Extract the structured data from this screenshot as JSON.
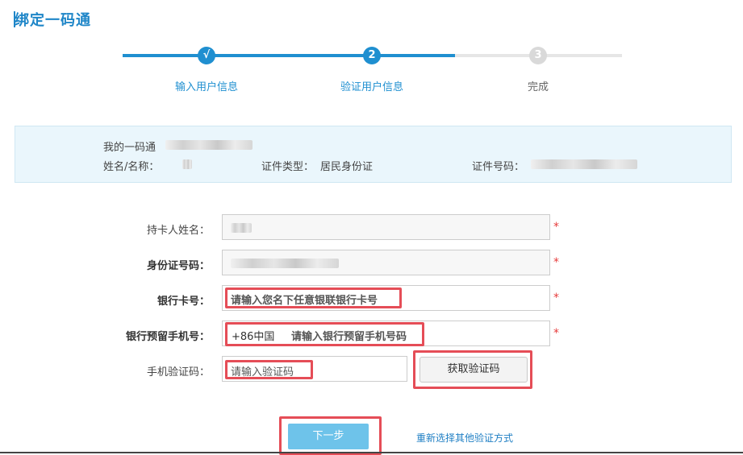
{
  "page": {
    "title": "绑定一码通"
  },
  "steps": [
    {
      "number": "√",
      "label": "输入用户信息"
    },
    {
      "number": "2",
      "label": "验证用户信息"
    },
    {
      "number": "3",
      "label": "完成"
    }
  ],
  "info": {
    "my_code_label": "我的一码通",
    "name_label": "姓名/名称：",
    "id_type_label": "证件类型：",
    "id_type_value": "居民身份证",
    "id_number_label": "证件号码："
  },
  "form": {
    "holder_name_label": "持卡人姓名：",
    "id_number_label": "身份证号码：",
    "bank_card_label": "银行卡号：",
    "bank_card_placeholder": "请输入您名下任意银联银行卡号",
    "phone_label": "银行预留手机号：",
    "phone_country_code": "+86中国",
    "phone_placeholder": "请输入银行预留手机号码",
    "sms_code_label": "手机验证码：",
    "sms_code_placeholder": "请输入验证码",
    "get_code_button": "获取验证码",
    "required_mark": "*"
  },
  "actions": {
    "next_button": "下一步",
    "alt_verify_link": "重新选择其他验证方式"
  }
}
